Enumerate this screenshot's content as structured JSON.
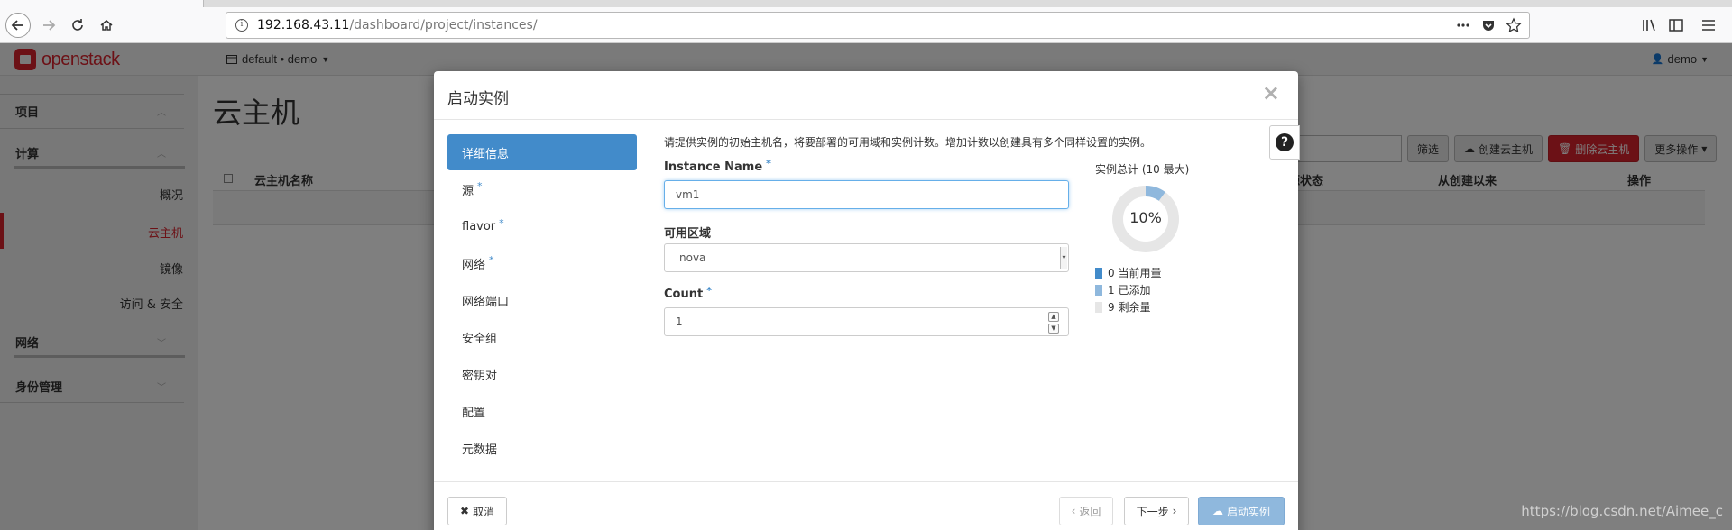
{
  "browser": {
    "url_host": "192.168.43.11",
    "url_path": "/dashboard/project/instances/"
  },
  "topbar": {
    "logo_text": "openstack",
    "project_label": "default • demo",
    "user_label": "demo"
  },
  "sidebar": {
    "sections": [
      {
        "label": "项目"
      },
      {
        "label": "计算"
      },
      {
        "label": "网络"
      },
      {
        "label": "身份管理"
      }
    ],
    "compute_items": [
      "概况",
      "云主机",
      "镜像",
      "访问 & 安全"
    ],
    "active_item": "云主机"
  },
  "page": {
    "title": "云主机",
    "actions": {
      "filter": "筛选",
      "create": "创建云主机",
      "delete": "删除云主机",
      "more": "更多操作"
    },
    "columns": [
      "云主机名称",
      "源状态",
      "从创建以来",
      "操作"
    ]
  },
  "modal": {
    "title": "启动实例",
    "close": "×",
    "steps": [
      {
        "label": "详细信息",
        "required": false
      },
      {
        "label": "源",
        "required": true
      },
      {
        "label": "flavor",
        "required": true
      },
      {
        "label": "网络",
        "required": true
      },
      {
        "label": "网络端口",
        "required": false
      },
      {
        "label": "安全组",
        "required": false
      },
      {
        "label": "密钥对",
        "required": false
      },
      {
        "label": "配置",
        "required": false
      },
      {
        "label": "元数据",
        "required": false
      }
    ],
    "required_mark": "*",
    "intro": "请提供实例的初始主机名，将要部署的可用域和实例计数。增加计数以创建具有多个同样设置的实例。",
    "fields": {
      "instance_name": {
        "label": "Instance Name",
        "value": "vm1"
      },
      "availability_zone": {
        "label": "可用区域",
        "value": "nova"
      },
      "count": {
        "label": "Count",
        "value": "1"
      }
    },
    "quota": {
      "title": "实例总计 (10 最大)",
      "percent_label": "10%",
      "used": 0,
      "added": 1,
      "remaining": 9,
      "max": 10,
      "legend": [
        {
          "value": "0",
          "label": "当前用量"
        },
        {
          "value": "1",
          "label": "已添加"
        },
        {
          "value": "9",
          "label": "剩余量"
        }
      ],
      "colors": {
        "used": "#428bca",
        "added": "#8fb8dd",
        "remaining": "#e6e6e6"
      }
    },
    "footer": {
      "cancel": "取消",
      "back": "返回",
      "next": "下一步",
      "launch": "启动实例"
    }
  },
  "watermark": "https://blog.csdn.net/Aimee_c"
}
